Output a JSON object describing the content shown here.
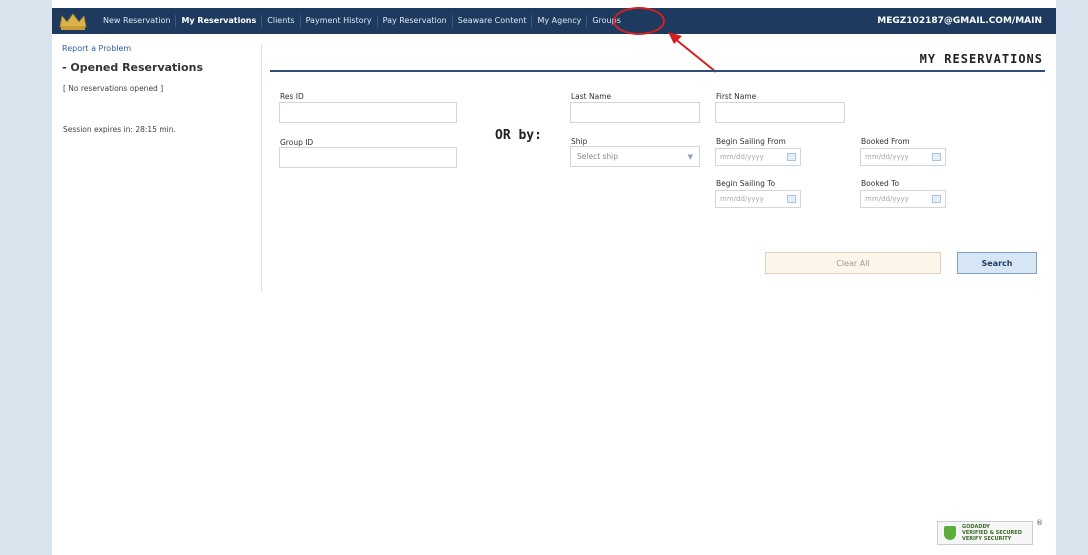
{
  "nav": {
    "items": [
      {
        "label": "New Reservation",
        "active": false
      },
      {
        "label": "My Reservations",
        "active": true
      },
      {
        "label": "Clients",
        "active": false
      },
      {
        "label": "Payment History",
        "active": false
      },
      {
        "label": "Pay Reservation",
        "active": false
      },
      {
        "label": "Seaware Content",
        "active": false
      },
      {
        "label": "My Agency",
        "active": false
      },
      {
        "label": "Groups",
        "active": false
      }
    ],
    "user": "MEGZ102187@GMAIL.COM/MAIN"
  },
  "sidebar": {
    "report_link": "Report a Problem",
    "opened_title": "- Opened Reservations",
    "no_reservations": "[ No reservations opened ]",
    "session": "Session expires in: 28:15 min."
  },
  "main": {
    "title": "MY RESERVATIONS",
    "or_by": "OR by:",
    "fields": {
      "res_id": "Res ID",
      "group_id": "Group ID",
      "last_name": "Last Name",
      "first_name": "First Name",
      "ship": "Ship",
      "ship_placeholder": "Select ship",
      "begin_sailing_from": "Begin Sailing From",
      "begin_sailing_to": "Begin Sailing To",
      "booked_from": "Booked From",
      "booked_to": "Booked To",
      "date_placeholder_dmy": "mm/dd/yyyy",
      "date_placeholder_mdy": "mm/dd/yyyy"
    },
    "clear_label": "Clear All",
    "search_label": "Search"
  },
  "badge": {
    "line1": "GODADDY",
    "line2": "VERIFIED & SECURED",
    "line3": "VERIFY SECURITY",
    "reg": "®"
  },
  "colors": {
    "topbar": "#1e3a5f",
    "annotation": "#d61f1f"
  }
}
